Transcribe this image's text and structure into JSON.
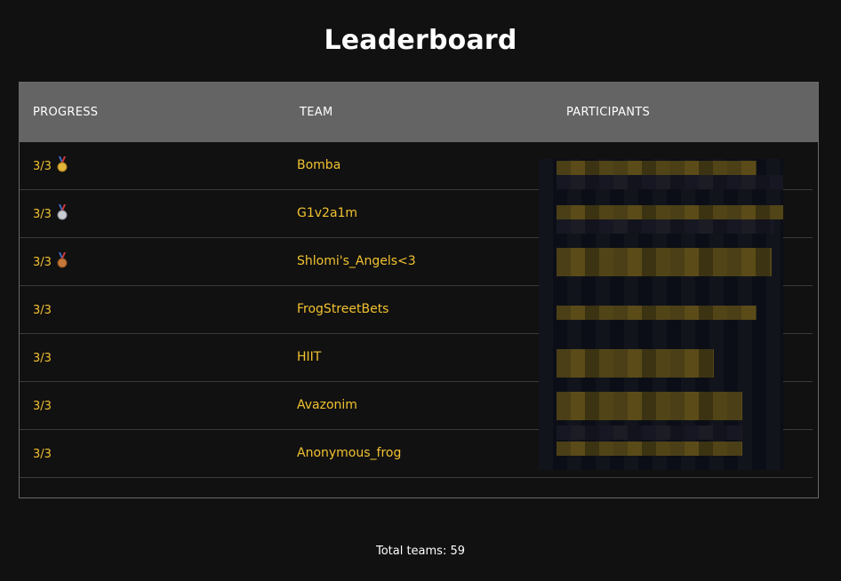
{
  "page": {
    "title": "Leaderboard"
  },
  "table": {
    "columns": [
      "PROGRESS",
      "TEAM",
      "PARTICIPANTS"
    ],
    "rows": [
      {
        "progress": "3/3",
        "medal": "gold-medal-icon",
        "team": "Bomba"
      },
      {
        "progress": "3/3",
        "medal": "silver-medal-icon",
        "team": "G1v2a1m"
      },
      {
        "progress": "3/3",
        "medal": "bronze-medal-icon",
        "team": "Shlomi's_Angels<3"
      },
      {
        "progress": "3/3",
        "medal": "",
        "team": "FrogStreetBets"
      },
      {
        "progress": "3/3",
        "medal": "",
        "team": "HIIT"
      },
      {
        "progress": "3/3",
        "medal": "",
        "team": "Avazonim"
      },
      {
        "progress": "3/3",
        "medal": "",
        "team": "Anonymous_frog"
      }
    ]
  },
  "footer": {
    "total_label": "Total teams: 59"
  },
  "colors": {
    "background": "#111111",
    "header_bg": "#646464",
    "accent": "#f2c230",
    "gold": "#e3b43a",
    "silver": "#c9ccd3",
    "bronze": "#c6773a"
  }
}
